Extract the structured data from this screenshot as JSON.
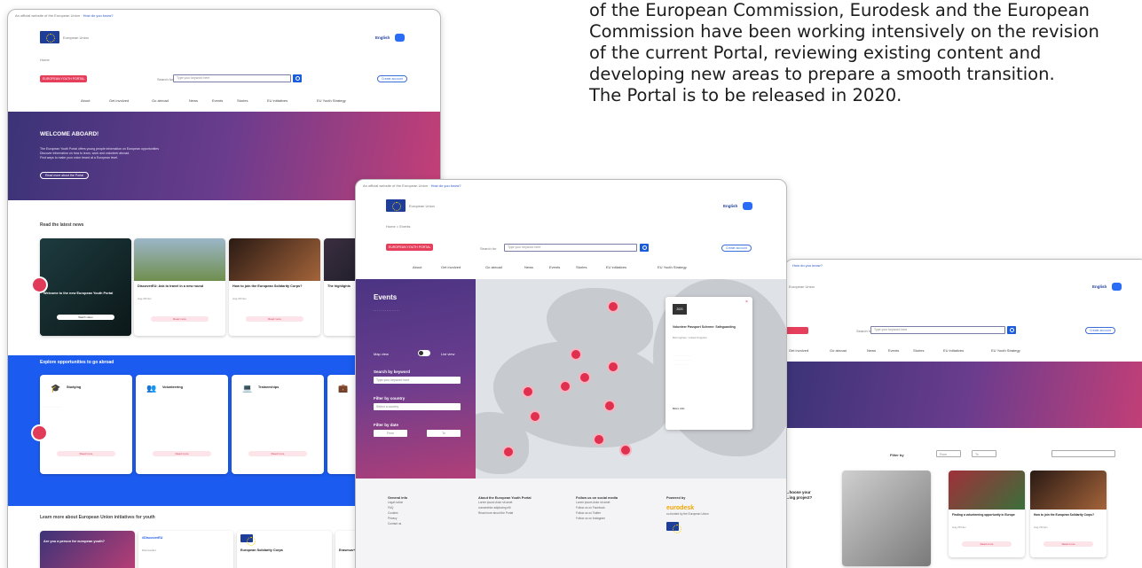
{
  "intro": {
    "lines": [
      "of the European Commission, Eurodesk and the European",
      "Commission have been working intensively on the revision",
      "of the current Portal, reviewing existing content and",
      "developing new areas to prepare a smooth transition.",
      "The Portal is to be released in 2020."
    ]
  },
  "common": {
    "official_notice": "An official website of the European Union",
    "how_know": "How do you know?",
    "eu_label": "European Union",
    "language": "English",
    "breadcrumb_home": "Home",
    "badge": "EUROPEAN YOUTH PORTAL",
    "search_label": "Search for",
    "search_placeholder": "Type your keyword here",
    "login": "Create account",
    "nav": [
      "About",
      "Get involved",
      "Go abroad",
      "News",
      "Events",
      "Stories",
      "EU initiatives",
      "EU Youth Strategy"
    ]
  },
  "window1": {
    "hero_title": "WELCOME ABOARD!",
    "hero_text": [
      "The European Youth Portal offers young people information on European opportunities",
      "Discover information on how to learn, work and volunteer abroad.",
      "Find ways to make your voice heard at a European level."
    ],
    "hero_button": "Read more about the Portal",
    "news_title": "Read the latest news",
    "news": [
      {
        "title": "Welcome to the new European Youth Portal",
        "date": "",
        "button": "Watch video"
      },
      {
        "title": "DiscoverEU: Ask to travel in a new round",
        "date": "Aug 28 Nov",
        "button": "Read more"
      },
      {
        "title": "How to join the European Solidarity Corps?",
        "date": "Aug 28 Nov",
        "button": "Read more"
      },
      {
        "title": "The highlights",
        "date": "",
        "button": ""
      }
    ],
    "explore_title": "Explore opportunities to go abroad",
    "explore": [
      {
        "title": "Studying",
        "icon": "graduation-icon",
        "button": "Read more"
      },
      {
        "title": "Volunteering",
        "icon": "people-icon",
        "button": "Read more"
      },
      {
        "title": "Traineeships",
        "icon": "laptop-icon",
        "button": "Read more"
      },
      {
        "title": "",
        "icon": "briefcase-icon",
        "button": ""
      }
    ],
    "learn_title": "Learn more about European Union initiatives for youth",
    "learn": [
      {
        "title": "Are you a person for european youth?"
      },
      {
        "title": "#DiscoverEU",
        "sub": "DiscoverEU"
      },
      {
        "title": "European Solidarity Corps"
      },
      {
        "title": "Erasmus+"
      }
    ]
  },
  "window2": {
    "events_title": "Events",
    "map_view": "Map view",
    "list_view": "List view",
    "keyword_label": "Search by keyword",
    "keyword_placeholder": "Type your keyword here",
    "country_label": "Filter by country",
    "country_placeholder": "Select a country",
    "date_label": "Filter by date",
    "from": "From",
    "to": "To",
    "popup": {
      "date": "2020",
      "title": "Volunteer Passport Scheme: Safeguarding",
      "place": "Birmingham, United Kingdom",
      "more": "More info"
    },
    "footer": [
      {
        "head": "General info",
        "items": [
          "Legal notice",
          "FAQ",
          "Cookies",
          "Privacy",
          "Contact us"
        ]
      },
      {
        "head": "About the European Youth Portal",
        "items": [
          "Lorem ipsum dolor sit amet",
          "consectetur adipiscing elit",
          "Read more about the Portal"
        ]
      },
      {
        "head": "Follow us on social media",
        "items": [
          "Lorem ipsum dolor sit amet",
          "Follow us on Facebook",
          "Follow us on Twitter",
          "Follow us on Instagram"
        ]
      },
      {
        "head": "Powered by",
        "items": [
          "co-funded by the European Union"
        ]
      }
    ],
    "eurodesk": "eurodesk"
  },
  "window3": {
    "filter_label": "Filter by",
    "from": "From",
    "to": "To",
    "card_left_title": [
      "…hoose your",
      "…ing project?"
    ],
    "cards": [
      {
        "title": "Finding a volunteering opportunity in Europe",
        "date": "Aug 28 Nov",
        "button": "Read more"
      },
      {
        "title": "How to join the European Solidarity Corps?",
        "date": "Aug 28 Nov",
        "button": "Read more"
      }
    ]
  },
  "colors": {
    "accent_red": "#e63f5b",
    "eu_blue": "#1f3e9a",
    "explore_blue": "#1b5bf0",
    "gradient_start": "#3b3377",
    "gradient_end": "#c53f76"
  }
}
